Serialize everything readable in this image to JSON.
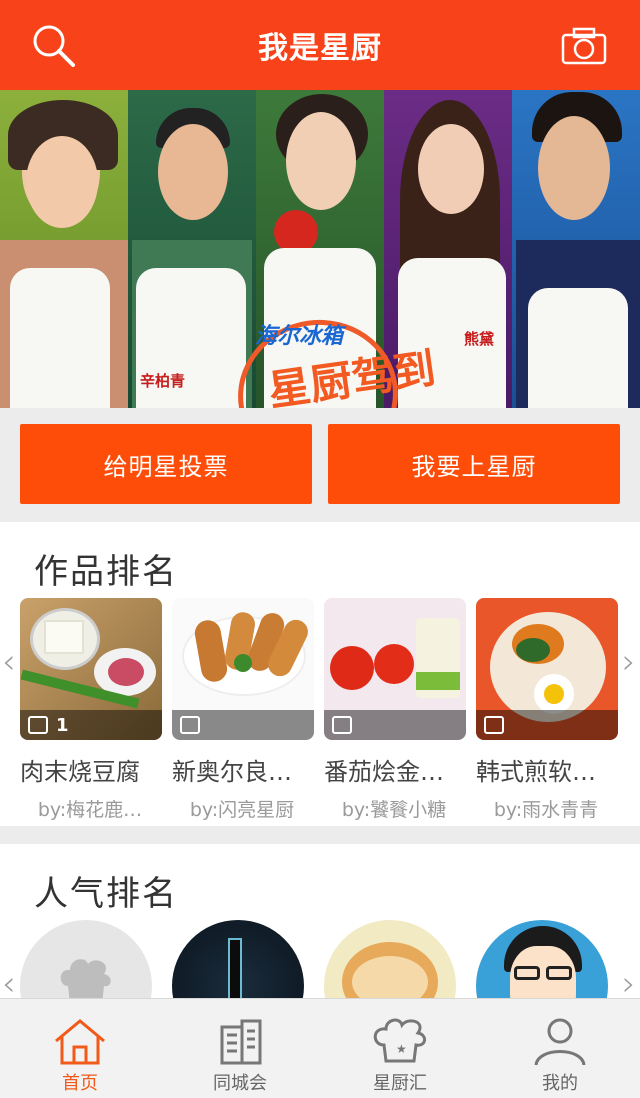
{
  "header": {
    "title": "我是星厨",
    "accent": "#f8431a"
  },
  "banner": {
    "name_tags": [
      "辛柏青",
      "熊黛"
    ],
    "logo_small": "海尔冰箱",
    "logo_main": "星厨驾到",
    "carousel_count": 3,
    "active_index": 0
  },
  "actions": {
    "vote_label": "给明星投票",
    "join_label": "我要上星厨"
  },
  "works": {
    "title": "作品排名",
    "items": [
      {
        "name": "肉末烧豆腐",
        "author": "by:梅花鹿…",
        "likes": "1"
      },
      {
        "name": "新奥尔良…",
        "author": "by:闪亮星厨",
        "likes": ""
      },
      {
        "name": "番茄烩金…",
        "author": "by:饕餮小糖",
        "likes": ""
      },
      {
        "name": "韩式煎软…",
        "author": "by:雨水青青",
        "likes": ""
      }
    ]
  },
  "popular": {
    "title": "人气排名"
  },
  "tabs": [
    {
      "label": "首页",
      "icon": "home-icon"
    },
    {
      "label": "同城会",
      "icon": "building-icon"
    },
    {
      "label": "星厨汇",
      "icon": "chef-hat-icon"
    },
    {
      "label": "我的",
      "icon": "user-icon"
    }
  ]
}
